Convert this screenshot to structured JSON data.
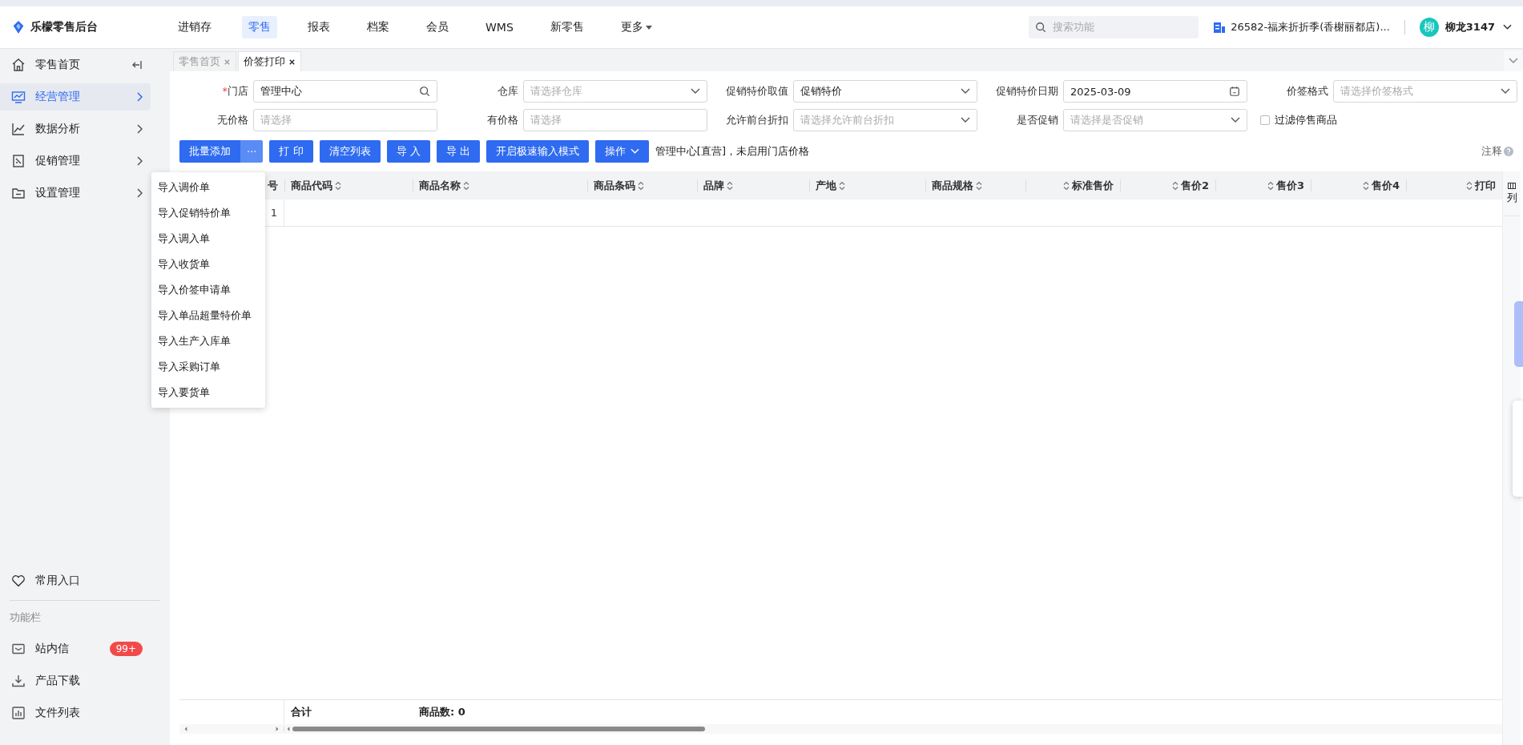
{
  "app": {
    "title": "乐檬零售后台"
  },
  "top_nav": [
    {
      "label": "进销存",
      "selected": false,
      "kind": "link"
    },
    {
      "label": "零售",
      "selected": true,
      "kind": "link"
    },
    {
      "label": "报表",
      "selected": false,
      "kind": "link"
    },
    {
      "label": "档案",
      "selected": false,
      "kind": "link"
    },
    {
      "label": "会员",
      "selected": false,
      "kind": "link"
    },
    {
      "label": "WMS",
      "selected": false,
      "kind": "link"
    },
    {
      "label": "新零售",
      "selected": false,
      "kind": "link"
    },
    {
      "label": "更多",
      "selected": false,
      "kind": "menu"
    }
  ],
  "search": {
    "placeholder": "搜索功能"
  },
  "store": "26582-福来折折季(香榭丽都店)...",
  "user": {
    "avatar": "柳",
    "name": "柳龙3147"
  },
  "sidebar": {
    "items": [
      {
        "label": "零售首页",
        "selected": false
      },
      {
        "label": "经营管理",
        "selected": true
      },
      {
        "label": "数据分析",
        "selected": false
      },
      {
        "label": "促销管理",
        "selected": false
      },
      {
        "label": "设置管理",
        "selected": false
      }
    ],
    "favorites": "常用入口",
    "section_title": "功能栏",
    "tools": [
      {
        "label": "站内信",
        "badge": "99+"
      },
      {
        "label": "产品下载"
      },
      {
        "label": "文件列表"
      }
    ]
  },
  "tabs": [
    {
      "label": "零售首页",
      "selected": false
    },
    {
      "label": "价签打印",
      "selected": true
    }
  ],
  "filters": [
    {
      "mark": "*",
      "label": "门店",
      "kind": "search",
      "value": "管理中心"
    },
    {
      "label": "仓库",
      "kind": "select",
      "placeholder": "请选择仓库"
    },
    {
      "label": "促销特价取值",
      "kind": "select",
      "value": "促销特价"
    },
    {
      "label": "促销特价日期",
      "kind": "date",
      "value": "2025-03-09"
    },
    {
      "label": "价签格式",
      "kind": "select",
      "placeholder": "请选择价签格式"
    },
    {
      "label": "无价格",
      "kind": "text",
      "placeholder": "请选择"
    },
    {
      "label": "有价格",
      "kind": "text",
      "placeholder": "请选择"
    },
    {
      "label": "允许前台折扣",
      "kind": "select",
      "placeholder": "请选择允许前台折扣"
    },
    {
      "label": "是否促销",
      "kind": "select",
      "placeholder": "请选择是否促销"
    },
    {
      "label": "过滤停售商品",
      "kind": "checkbox",
      "checked": false
    }
  ],
  "toolbar": {
    "buttons": [
      {
        "label": "批量添加",
        "kind": "split",
        "more": "···"
      },
      {
        "label": "打 印",
        "kind": "plain"
      },
      {
        "label": "清空列表",
        "kind": "plain"
      },
      {
        "label": "导 入",
        "kind": "plain"
      },
      {
        "label": "导 出",
        "kind": "plain"
      },
      {
        "label": "开启极速输入模式",
        "kind": "plain"
      },
      {
        "label": "操作",
        "kind": "dropdown"
      }
    ],
    "note": "管理中心[直营]，未启用门店价格",
    "help": "注释"
  },
  "import_menu": [
    "导入调价单",
    "导入促销特价单",
    "导入调入单",
    "导入收货单",
    "导入价签申请单",
    "导入单品超量特价单",
    "导入生产入库单",
    "导入采购订单",
    "导入要货单"
  ],
  "table": {
    "columns": [
      {
        "label": "号",
        "sortable": false
      },
      {
        "label": "商品代码",
        "sortable": true
      },
      {
        "label": "商品名称",
        "sortable": true
      },
      {
        "label": "商品条码",
        "sortable": true
      },
      {
        "label": "品牌",
        "sortable": true
      },
      {
        "label": "产地",
        "sortable": true
      },
      {
        "label": "商品规格",
        "sortable": true
      },
      {
        "label": "标准售价",
        "sortable": true
      },
      {
        "label": "售价2",
        "sortable": true
      },
      {
        "label": "售价3",
        "sortable": true
      },
      {
        "label": "售价4",
        "sortable": true
      },
      {
        "label": "打印",
        "sortable": true
      }
    ],
    "rows": [
      {
        "cells": [
          "1"
        ]
      }
    ],
    "column_settings": "列",
    "footer": {
      "total_label": "合计",
      "count": "商品数: 0"
    }
  }
}
